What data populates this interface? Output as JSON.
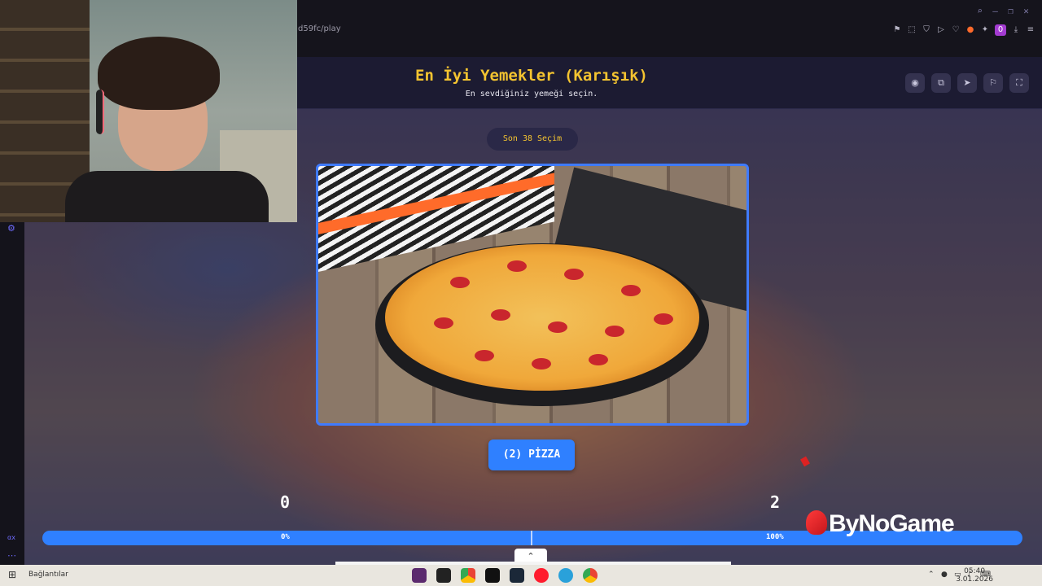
{
  "browser": {
    "url_fragment": "d59fc/play",
    "window_controls": [
      "search-icon",
      "minimize-icon",
      "maximize-icon",
      "close-icon"
    ],
    "toolbar_icons": [
      "bookmark-icon",
      "screenshot-icon",
      "shield-icon",
      "play-icon",
      "heart-icon",
      "flame-icon",
      "extensions-icon",
      "profile-icon",
      "download-icon",
      "menu-icon"
    ],
    "profile_badge": "0"
  },
  "game": {
    "title": "En İyi Yemekler (Karışık)",
    "subtitle": "En sevdiğiniz yemeği seçin.",
    "header_buttons": [
      "eye-icon",
      "share-icon",
      "send-icon",
      "flag-icon",
      "fullscreen-icon"
    ],
    "recent_pill": "Son 38 Seçim",
    "choice_label": "(2) PİZZA",
    "score_left": "0",
    "score_right": "2",
    "progress": {
      "left_percent_label": "0%",
      "right_percent_label": "100%",
      "left_fraction": 0.0,
      "right_fraction": 1.0
    },
    "brand": "ByNoGame",
    "colors": {
      "accent": "#2f80ff",
      "title": "#f4c430",
      "header_bg": "#1c1b32"
    }
  },
  "taskbar": {
    "links_label": "Bağlantılar",
    "time": "05:40",
    "date": "3.01.2026",
    "apps": [
      "vscode-icon",
      "obs-icon",
      "chrome-icon",
      "epic-games-icon",
      "steam-icon",
      "opera-icon",
      "telegram-icon",
      "chrome-alt-icon"
    ]
  }
}
